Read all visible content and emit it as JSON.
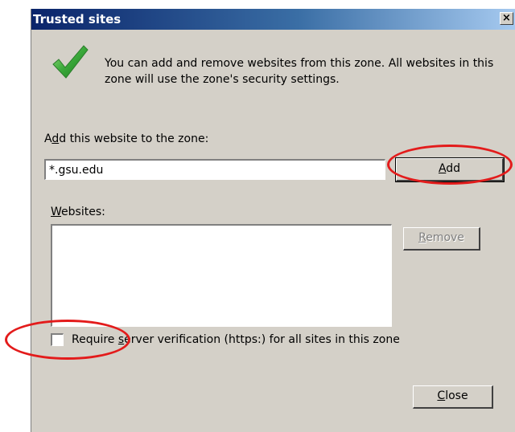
{
  "window": {
    "title": "Trusted sites",
    "close_glyph": "×"
  },
  "icons": {
    "zone_icon": "checkmark-icon",
    "zone_icon_color": "#3aa83a"
  },
  "info": {
    "text": "You can add and remove websites from this zone. All websites in this zone will use the zone's security settings."
  },
  "add_section": {
    "label_pre": "A",
    "label_access_key": "d",
    "label_post": "d this website to the zone:",
    "input_value": "*.gsu.edu",
    "add_button_access_key": "A",
    "add_button_rest": "dd"
  },
  "websites_section": {
    "label_access_key": "W",
    "label_rest": "ebsites:",
    "items": [],
    "remove_button_access_key": "R",
    "remove_button_rest": "emove"
  },
  "https_option": {
    "checked": false,
    "label_pre": "Require ",
    "label_access_key": "s",
    "label_post": "erver verification (https:) for all sites in this zone"
  },
  "footer": {
    "close_button_access_key": "C",
    "close_button_rest": "lose"
  },
  "annotations": {
    "color": "#e31b1b"
  }
}
